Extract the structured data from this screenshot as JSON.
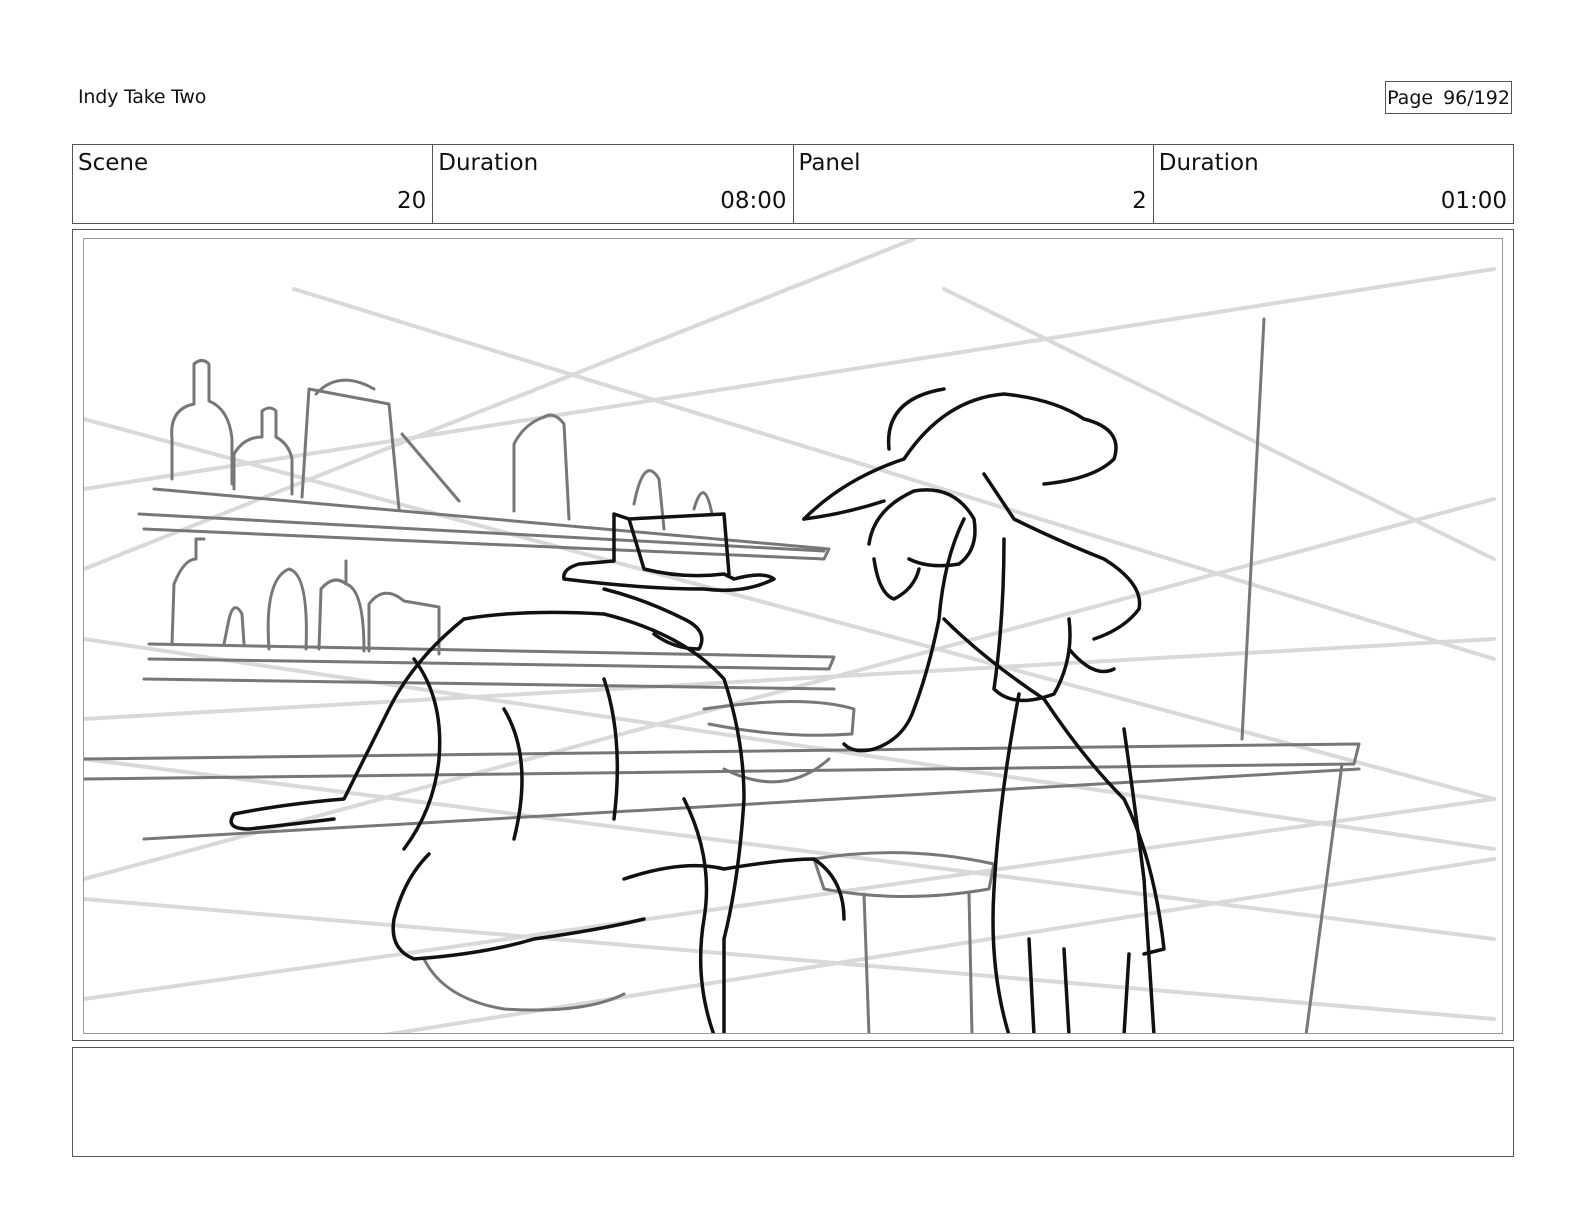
{
  "header": {
    "title": "Indy Take Two",
    "page_label": "Page",
    "page_value": "96/192"
  },
  "info": {
    "scene_label": "Scene",
    "scene_value": "20",
    "scene_duration_label": "Duration",
    "scene_duration_value": "08:00",
    "panel_label": "Panel",
    "panel_value": "2",
    "panel_duration_label": "Duration",
    "panel_duration_value": "01:00"
  },
  "notes": {
    "text": ""
  }
}
